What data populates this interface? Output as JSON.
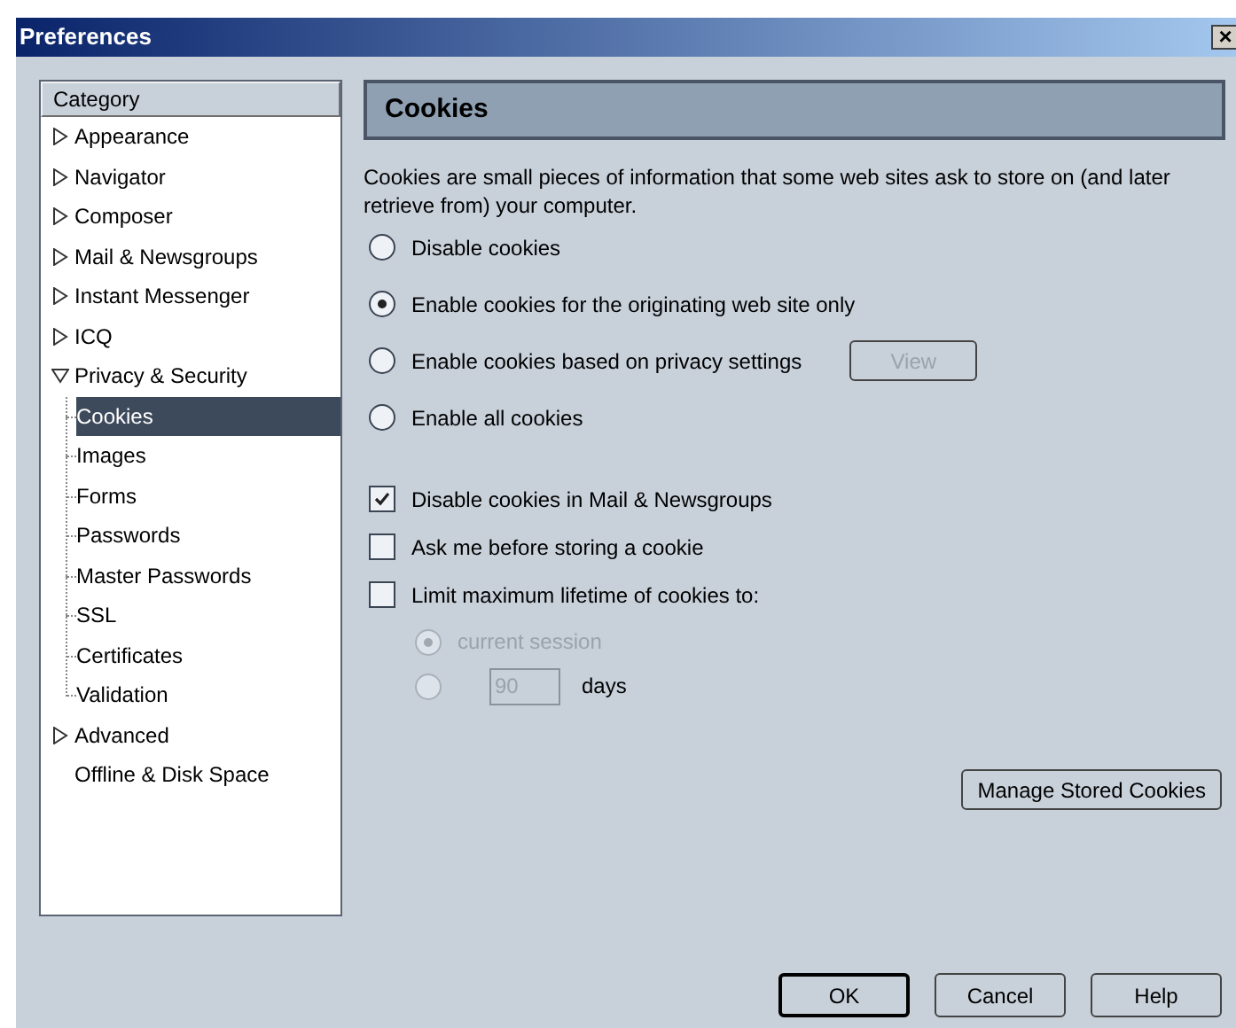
{
  "window": {
    "title": "Preferences",
    "close": "×"
  },
  "sidebar": {
    "header": "Category",
    "items": [
      {
        "label": "Appearance",
        "kind": "folder",
        "expanded": false,
        "selected": false
      },
      {
        "label": "Navigator",
        "kind": "folder",
        "expanded": false,
        "selected": false
      },
      {
        "label": "Composer",
        "kind": "folder",
        "expanded": false,
        "selected": false
      },
      {
        "label": "Mail & Newsgroups",
        "kind": "folder",
        "expanded": false,
        "selected": false
      },
      {
        "label": "Instant Messenger",
        "kind": "folder",
        "expanded": false,
        "selected": false
      },
      {
        "label": "ICQ",
        "kind": "folder",
        "expanded": false,
        "selected": false
      },
      {
        "label": "Privacy & Security",
        "kind": "folder",
        "expanded": true,
        "selected": false,
        "children": [
          {
            "label": "Cookies",
            "selected": true
          },
          {
            "label": "Images",
            "selected": false
          },
          {
            "label": "Forms",
            "selected": false
          },
          {
            "label": "Passwords",
            "selected": false
          },
          {
            "label": "Master Passwords",
            "selected": false
          },
          {
            "label": "SSL",
            "selected": false
          },
          {
            "label": "Certificates",
            "selected": false
          },
          {
            "label": "Validation",
            "selected": false
          }
        ]
      },
      {
        "label": "Advanced",
        "kind": "folder",
        "expanded": false,
        "selected": false
      },
      {
        "label": "Offline & Disk Space",
        "kind": "leaf",
        "selected": false
      }
    ]
  },
  "panel": {
    "title": "Cookies",
    "description": "Cookies are small pieces of information that some web sites ask to store on (and later retrieve from) your computer.",
    "cookie_options": [
      {
        "label": "Disable cookies",
        "selected": false
      },
      {
        "label": "Enable cookies for the originating web site only",
        "selected": true
      },
      {
        "label": "Enable cookies based on privacy settings",
        "selected": false,
        "button": {
          "label": "View",
          "disabled": true
        }
      },
      {
        "label": "Enable all cookies",
        "selected": false
      }
    ],
    "checkboxes": [
      {
        "label": "Disable cookies in Mail & Newsgroups",
        "checked": true
      },
      {
        "label": "Ask me before storing a cookie",
        "checked": false
      },
      {
        "label": "Limit maximum lifetime of cookies to:",
        "checked": false
      }
    ],
    "lifetime_options": [
      {
        "kind": "label",
        "label": "current session",
        "selected": true,
        "disabled": true
      },
      {
        "kind": "field",
        "value": "90",
        "unit": "days",
        "selected": false,
        "disabled": true
      }
    ],
    "manage_button": "Manage Stored Cookies"
  },
  "buttons": [
    {
      "label": "OK",
      "default": true
    },
    {
      "label": "Cancel",
      "default": false
    },
    {
      "label": "Help",
      "default": false
    }
  ]
}
